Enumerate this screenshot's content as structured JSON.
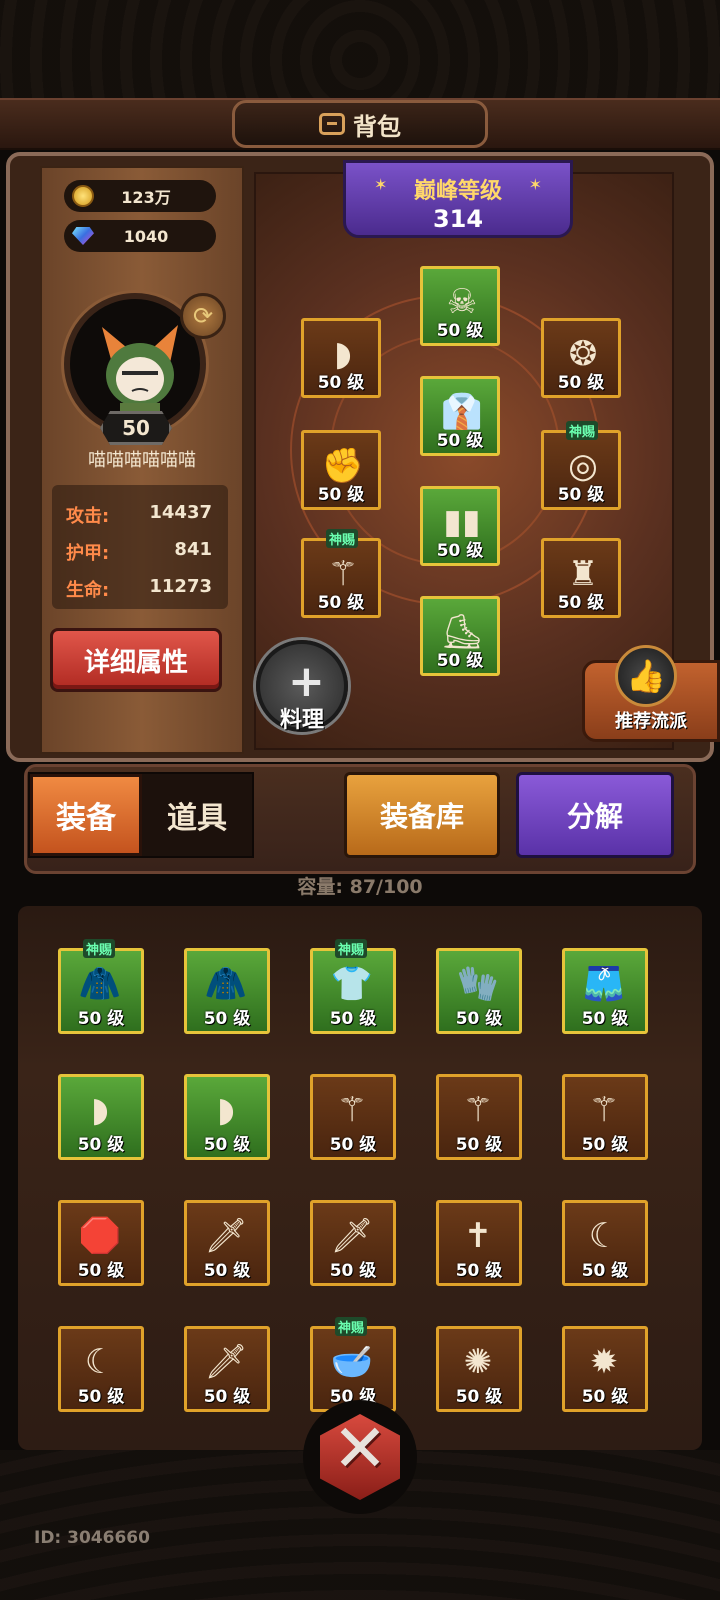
{
  "title": "背包",
  "currency": {
    "gold": "123万",
    "gems": "1040"
  },
  "player": {
    "level": "50",
    "name": "喵喵喵喵喵喵"
  },
  "stats": [
    {
      "label": "攻击:",
      "value": "14437"
    },
    {
      "label": "护甲:",
      "value": "841"
    },
    {
      "label": "生命:",
      "value": "11273"
    }
  ],
  "detail_button": "详细属性",
  "peak": {
    "label": "巅峰等级",
    "value": "314"
  },
  "equipped": [
    {
      "id": "helmet",
      "level": "50 级",
      "icon": "☠",
      "tag": "",
      "green": true
    },
    {
      "id": "shoulder",
      "level": "50 级",
      "icon": "◗",
      "tag": "",
      "green": false
    },
    {
      "id": "necklace",
      "level": "50 级",
      "icon": "❂",
      "tag": "",
      "green": false
    },
    {
      "id": "armor",
      "level": "50 级",
      "icon": "👔",
      "tag": "",
      "green": true
    },
    {
      "id": "glove",
      "level": "50 级",
      "icon": "✊",
      "tag": "",
      "green": false
    },
    {
      "id": "ring",
      "level": "50 级",
      "icon": "◎",
      "tag": "神赐",
      "green": false
    },
    {
      "id": "pants",
      "level": "50 级",
      "icon": "▮▮",
      "tag": "",
      "green": true
    },
    {
      "id": "weapon",
      "level": "50 级",
      "icon": "⚚",
      "tag": "神赐",
      "green": false
    },
    {
      "id": "charm",
      "level": "50 级",
      "icon": "♜",
      "tag": "",
      "green": false
    },
    {
      "id": "boots",
      "level": "50 级",
      "icon": "⛸",
      "tag": "",
      "green": true
    }
  ],
  "cook_label": "料理",
  "recommend_label": "推荐流派",
  "tabs": {
    "equipment": "装备",
    "items": "道具"
  },
  "buttons": {
    "library": "装备库",
    "decompose": "分解"
  },
  "capacity": {
    "label": "容量:",
    "value": "87/100"
  },
  "inventory": [
    {
      "level": "50 级",
      "icon": "🧥",
      "tag": "神赐",
      "green": true
    },
    {
      "level": "50 级",
      "icon": "🧥",
      "tag": "",
      "green": true
    },
    {
      "level": "50 级",
      "icon": "👕",
      "tag": "神赐",
      "green": true
    },
    {
      "level": "50 级",
      "icon": "🧤",
      "tag": "",
      "green": true
    },
    {
      "level": "50 级",
      "icon": "🩳",
      "tag": "",
      "green": true
    },
    {
      "level": "50 级",
      "icon": "◗",
      "tag": "",
      "green": true
    },
    {
      "level": "50 级",
      "icon": "◗",
      "tag": "",
      "green": true
    },
    {
      "level": "50 级",
      "icon": "⚚",
      "tag": "",
      "green": false
    },
    {
      "level": "50 级",
      "icon": "⚚",
      "tag": "",
      "green": false
    },
    {
      "level": "50 级",
      "icon": "⚚",
      "tag": "",
      "green": false
    },
    {
      "level": "50 级",
      "icon": "🛑",
      "tag": "",
      "green": false
    },
    {
      "level": "50 级",
      "icon": "🗡",
      "tag": "",
      "green": false
    },
    {
      "level": "50 级",
      "icon": "🗡",
      "tag": "",
      "green": false
    },
    {
      "level": "50 级",
      "icon": "✝",
      "tag": "",
      "green": false
    },
    {
      "level": "50 级",
      "icon": "☾",
      "tag": "",
      "green": false
    },
    {
      "level": "50 级",
      "icon": "☾",
      "tag": "",
      "green": false
    },
    {
      "level": "50 级",
      "icon": "🗡",
      "tag": "",
      "green": false
    },
    {
      "level": "50 级",
      "icon": "🥣",
      "tag": "神赐",
      "green": false
    },
    {
      "level": "50 级",
      "icon": "✺",
      "tag": "",
      "green": false
    },
    {
      "level": "50 级",
      "icon": "✹",
      "tag": "",
      "green": false
    }
  ],
  "user_id": "ID: 3046660",
  "colors": {
    "accent_orange": "#c4531e",
    "accent_purple": "#5a32a8",
    "slot_border": "#e0a22a",
    "rare_green": "#4a8f2c"
  }
}
